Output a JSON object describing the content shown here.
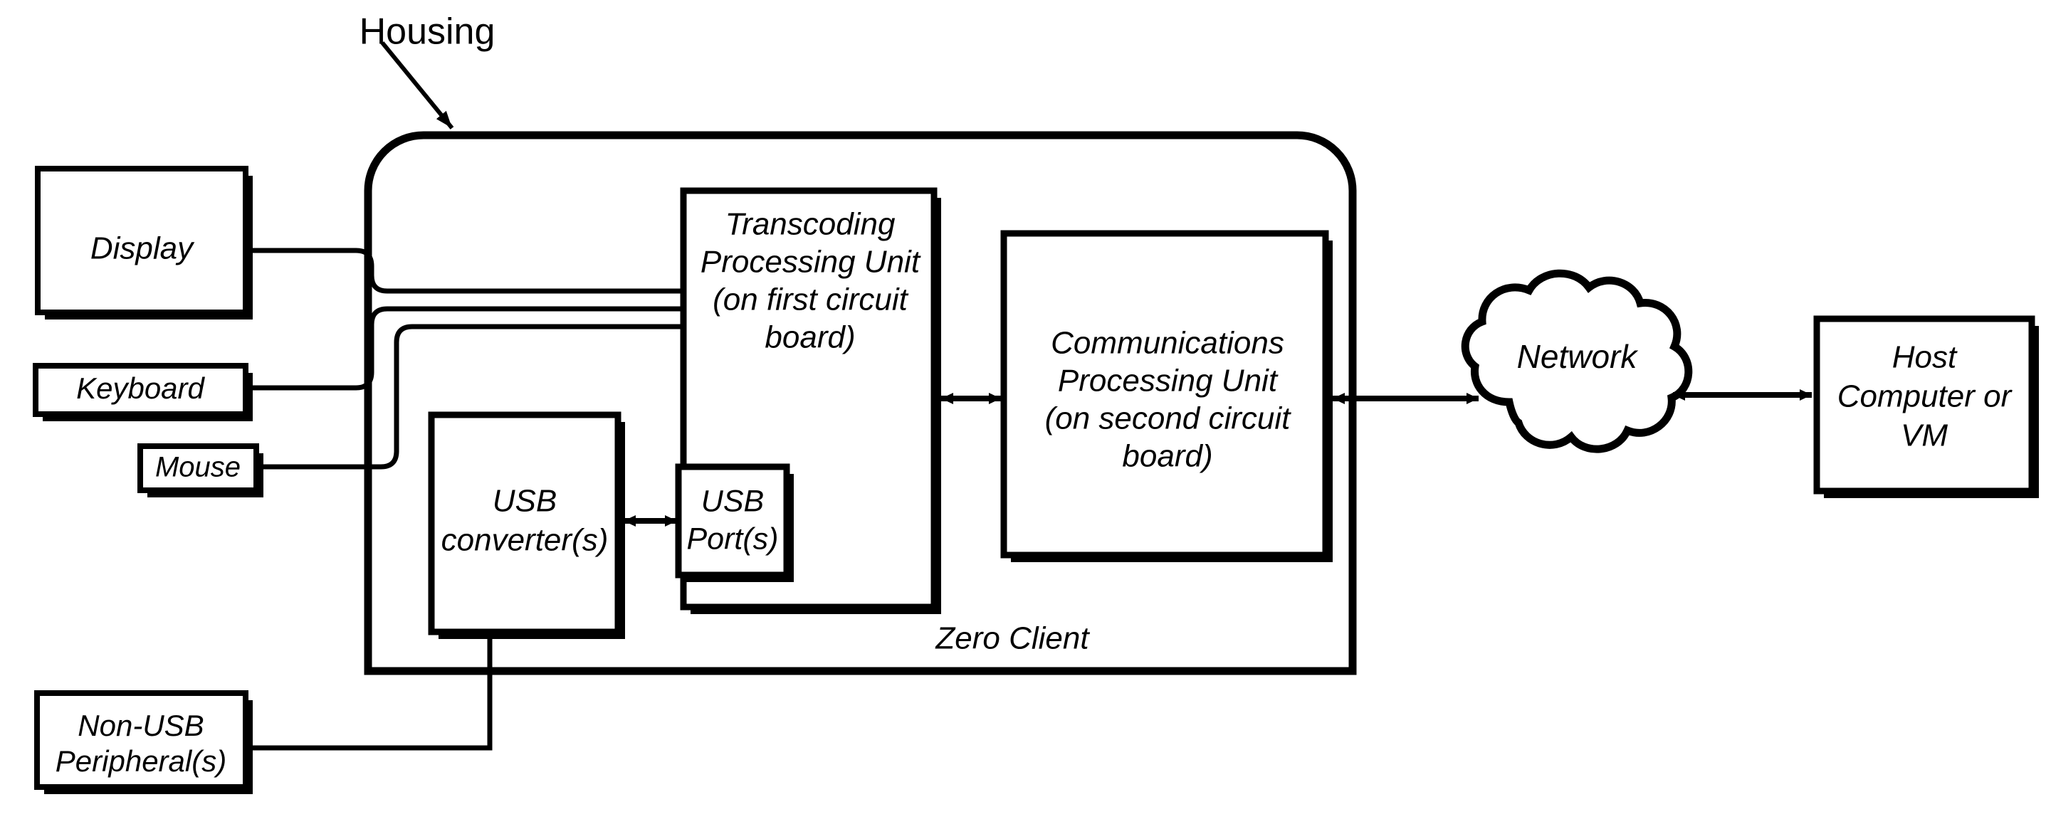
{
  "diagram": {
    "title_label": "Housing",
    "enclosure_label": "Zero Client",
    "colors": {
      "stroke": "#000000",
      "fill": "#ffffff",
      "background": "#ffffff"
    },
    "nodes": {
      "display": {
        "label": "Display"
      },
      "keyboard": {
        "label": "Keyboard"
      },
      "mouse": {
        "label": "Mouse"
      },
      "non_usb_peripherals": {
        "label_line1": "Non-USB",
        "label_line2": "Peripheral(s)"
      },
      "usb_converters": {
        "label_line1": "USB",
        "label_line2": "converter(s)"
      },
      "usb_ports": {
        "label_line1": "USB",
        "label_line2": "Port(s)"
      },
      "transcoding_processing_unit": {
        "label_line1": "Transcoding",
        "label_line2": "Processing Unit",
        "label_line3": "(on first circuit",
        "label_line4": "board)"
      },
      "communications_processing_unit": {
        "label_line1": "Communications",
        "label_line2": "Processing Unit",
        "label_line3": "(on second circuit",
        "label_line4": "board)"
      },
      "network": {
        "label": "Network"
      },
      "host": {
        "label_line1": "Host",
        "label_line2": "Computer or",
        "label_line3": "VM"
      }
    },
    "connectors": {
      "display_to_tpu": "line",
      "keyboard_to_tpu": "line",
      "mouse_to_tpu": "line",
      "non_usb_to_usb_converter": "line",
      "usb_converter_to_usb_port": "double-arrow",
      "tpu_to_cpu": "double-arrow",
      "cpu_to_network": "double-arrow",
      "network_to_host": "double-arrow",
      "housing_callout": "arrow"
    }
  }
}
